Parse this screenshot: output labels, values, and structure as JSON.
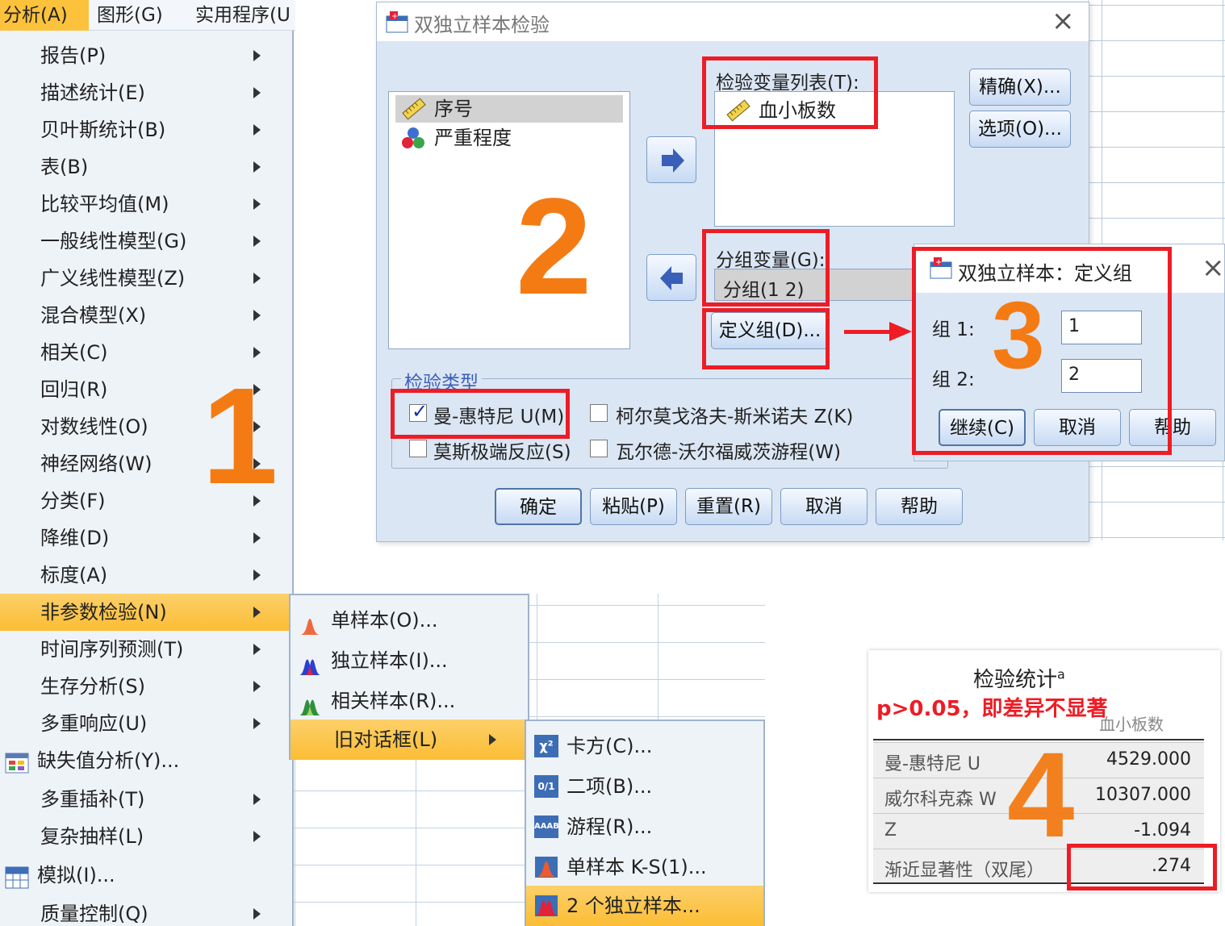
{
  "menubar": {
    "analyze": "分析(A)",
    "graphs": "图形(G)",
    "utilities": "实用程序(U"
  },
  "main_menu": [
    {
      "label": "报告(P)",
      "arrow": true
    },
    {
      "label": "描述统计(E)",
      "arrow": true
    },
    {
      "label": "贝叶斯统计(B)",
      "arrow": true
    },
    {
      "label": "表(B)",
      "arrow": true
    },
    {
      "label": "比较平均值(M)",
      "arrow": true
    },
    {
      "label": "一般线性模型(G)",
      "arrow": true
    },
    {
      "label": "广义线性模型(Z)",
      "arrow": true
    },
    {
      "label": "混合模型(X)",
      "arrow": true
    },
    {
      "label": "相关(C)",
      "arrow": true
    },
    {
      "label": "回归(R)",
      "arrow": true
    },
    {
      "label": "对数线性(O)",
      "arrow": true
    },
    {
      "label": "神经网络(W)",
      "arrow": true
    },
    {
      "label": "分类(F)",
      "arrow": true
    },
    {
      "label": "降维(D)",
      "arrow": true
    },
    {
      "label": "标度(A)",
      "arrow": true
    },
    {
      "label": "非参数检验(N)",
      "arrow": true
    },
    {
      "label": "时间序列预测(T)",
      "arrow": true
    },
    {
      "label": "生存分析(S)",
      "arrow": true
    },
    {
      "label": "多重响应(U)",
      "arrow": true
    },
    {
      "label": "缺失值分析(Y)...",
      "arrow": false
    },
    {
      "label": "多重插补(T)",
      "arrow": true
    },
    {
      "label": "复杂抽样(L)",
      "arrow": true
    },
    {
      "label": "模拟(I)...",
      "arrow": false
    },
    {
      "label": "质量控制(Q)",
      "arrow": true
    }
  ],
  "nonparam_submenu": {
    "one_sample": "单样本(O)...",
    "independent": "独立样本(I)...",
    "related": "相关样本(R)...",
    "legacy": "旧对话框(L)"
  },
  "legacy_submenu": {
    "chisquare": "卡方(C)...",
    "binomial": "二项(B)...",
    "runs": "游程(R)...",
    "ks_one": "单样本 K-S(1)...",
    "two_indep": "2 个独立样本..."
  },
  "legacy_icons": {
    "chisquare": "χ²",
    "binomial": "0/1",
    "runs": "AAAB"
  },
  "dialog": {
    "title": "双独立样本检验",
    "vars": [
      "序号",
      "严重程度"
    ],
    "test_var_label": "检验变量列表(T):",
    "test_var": "血小板数",
    "exact_btn": "精确(X)...",
    "options_btn": "选项(O)...",
    "grouping_label": "分组变量(G):",
    "grouping_value": "分组(1 2)",
    "define_groups_btn": "定义组(D)...",
    "test_type_legend": "检验类型",
    "mann_whitney": "曼-惠特尼 U(M)",
    "ks_z": "柯尔莫戈洛夫-斯米诺夫 Z(K)",
    "moses": "莫斯极端反应(S)",
    "wald": "瓦尔德-沃尔福威茨游程(W)",
    "ok": "确定",
    "paste": "粘贴(P)",
    "reset": "重置(R)",
    "cancel": "取消",
    "help": "帮助"
  },
  "define_groups": {
    "title": "双独立样本：定义组",
    "group1_label": "组 1:",
    "group1_value": "1",
    "group2_label": "组 2:",
    "group2_value": "2",
    "continue": "继续(C)",
    "cancel": "取消",
    "help": "帮助"
  },
  "output": {
    "title": "检验统计",
    "title_sup": "a",
    "note": "p>0.05，即差异不显著",
    "col_header": "血小板数",
    "rows": [
      {
        "k": "曼-惠特尼 U",
        "v": "4529.000"
      },
      {
        "k": "威尔科克森 W",
        "v": "10307.000"
      },
      {
        "k": "Z",
        "v": "-1.094"
      },
      {
        "k": "渐近显著性（双尾）",
        "v": ".274"
      }
    ]
  },
  "step_numbers": {
    "one": "1",
    "two": "2",
    "three": "3",
    "four": "4"
  },
  "colors": {
    "highlight": "#fbbd34",
    "annotation_red": "#ee1c25",
    "step_orange": "#f47b14",
    "dialog_bg": "#dbe6f4"
  }
}
